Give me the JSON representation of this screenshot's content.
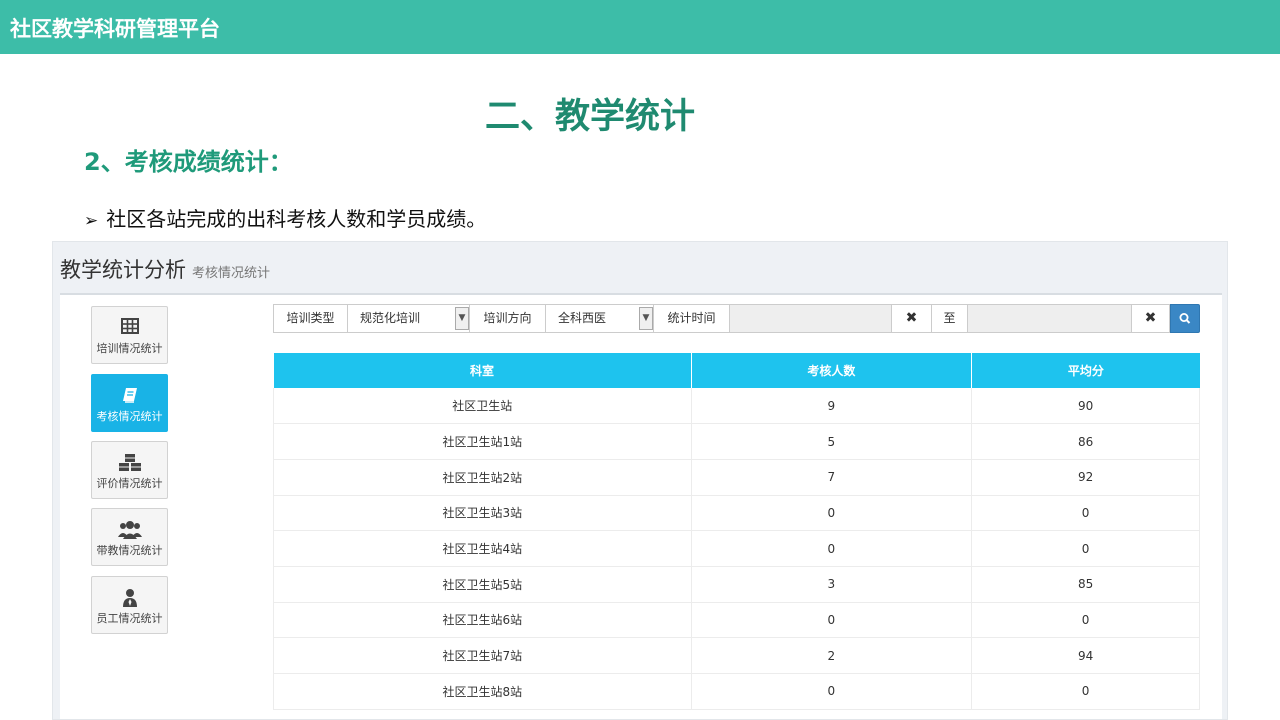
{
  "topbar": {
    "title": "社区教学科研管理平台"
  },
  "slide": {
    "heading": "二、教学统计",
    "subheading": "2、考核成绩统计：",
    "bullet_arrow": "➢",
    "bullet": "社区各站完成的出科考核人数和学员成绩。"
  },
  "app": {
    "title": "教学统计分析",
    "subtitle": "考核情况统计",
    "nav": [
      {
        "label": "培训情况统计",
        "icon": "table-icon",
        "active": false
      },
      {
        "label": "考核情况统计",
        "icon": "book-icon",
        "active": true
      },
      {
        "label": "评价情况统计",
        "icon": "cubes-icon",
        "active": false
      },
      {
        "label": "带教情况统计",
        "icon": "users-icon",
        "active": false
      },
      {
        "label": "员工情况统计",
        "icon": "user-tie-icon",
        "active": false
      }
    ],
    "filters": {
      "train_type_label": "培训类型",
      "train_type_value": "规范化培训",
      "direction_label": "培训方向",
      "direction_value": "全科西医",
      "time_label": "统计时间",
      "start_value": "",
      "to_label": "至",
      "end_value": "",
      "clear_glyph": "✖"
    },
    "table": {
      "headers": [
        "科室",
        "考核人数",
        "平均分"
      ],
      "rows": [
        [
          "社区卫生站",
          "9",
          "90"
        ],
        [
          "社区卫生站1站",
          "5",
          "86"
        ],
        [
          "社区卫生站2站",
          "7",
          "92"
        ],
        [
          "社区卫生站3站",
          "0",
          "0"
        ],
        [
          "社区卫生站4站",
          "0",
          "0"
        ],
        [
          "社区卫生站5站",
          "3",
          "85"
        ],
        [
          "社区卫生站6站",
          "0",
          "0"
        ],
        [
          "社区卫生站7站",
          "2",
          "94"
        ],
        [
          "社区卫生站8站",
          "0",
          "0"
        ]
      ]
    },
    "colors": {
      "topbar": "#3dbda8",
      "accent": "#19b3e6",
      "table_header": "#1ec3ee",
      "search_button": "#3a87c5",
      "heading_green": "#1f8a70"
    }
  }
}
